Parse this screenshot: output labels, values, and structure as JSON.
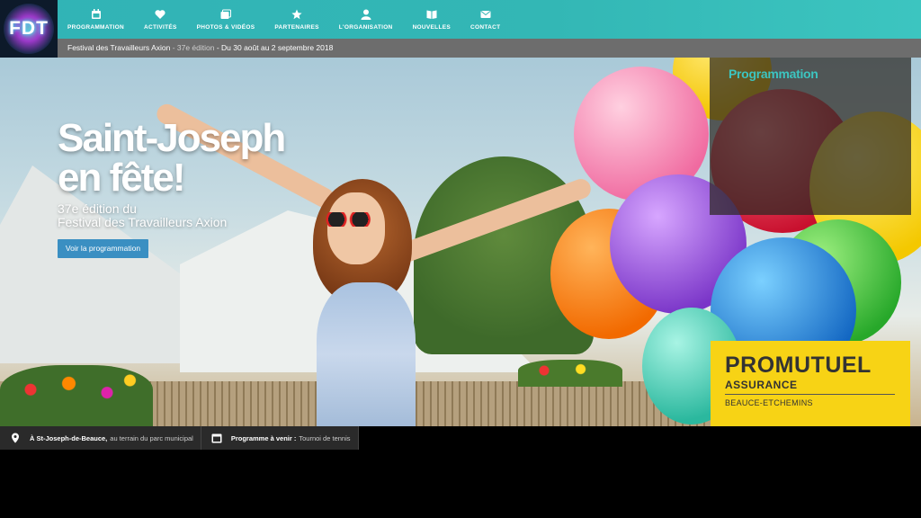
{
  "logo": {
    "text": "FDT"
  },
  "nav": {
    "items": [
      {
        "label": "PROGRAMMATION",
        "icon": "calendar-icon"
      },
      {
        "label": "ACTIVITÉS",
        "icon": "heart-icon"
      },
      {
        "label": "PHOTOS & VIDÉOS",
        "icon": "photos-icon"
      },
      {
        "label": "PARTENAIRES",
        "icon": "star-icon"
      },
      {
        "label": "L'ORGANISATION",
        "icon": "user-icon"
      },
      {
        "label": "NOUVELLES",
        "icon": "book-icon"
      },
      {
        "label": "CONTACT",
        "icon": "envelope-icon"
      }
    ]
  },
  "subbar": {
    "name": "Festival des Travailleurs Axion",
    "edition": " - 37e édition",
    "dates": " - Du 30 août au 2 septembre 2018"
  },
  "hero": {
    "title_line1": "Saint-Joseph",
    "title_line2": "en fête!",
    "sub_line1": "37e édition du",
    "sub_line2": "Festival des Travailleurs Axion",
    "cta": "Voir la programmation"
  },
  "programmation_box": {
    "title": "Programmation"
  },
  "sponsor": {
    "name": "PROMUTUEL",
    "line1": "ASSURANCE",
    "line2": "BEAUCE-ETCHEMINS"
  },
  "infobar": {
    "location_strong": "À St-Joseph-de-Beauce,",
    "location_text": "au terrain du parc municipal",
    "upcoming_strong": "Programme à venir :",
    "upcoming_text": "Tournoi de tennis"
  },
  "colors": {
    "teal": "#33b7b5",
    "cta_blue": "#3a8fc2",
    "sponsor_yellow": "#f7d315",
    "subbar_gray": "#6d6d6d"
  }
}
